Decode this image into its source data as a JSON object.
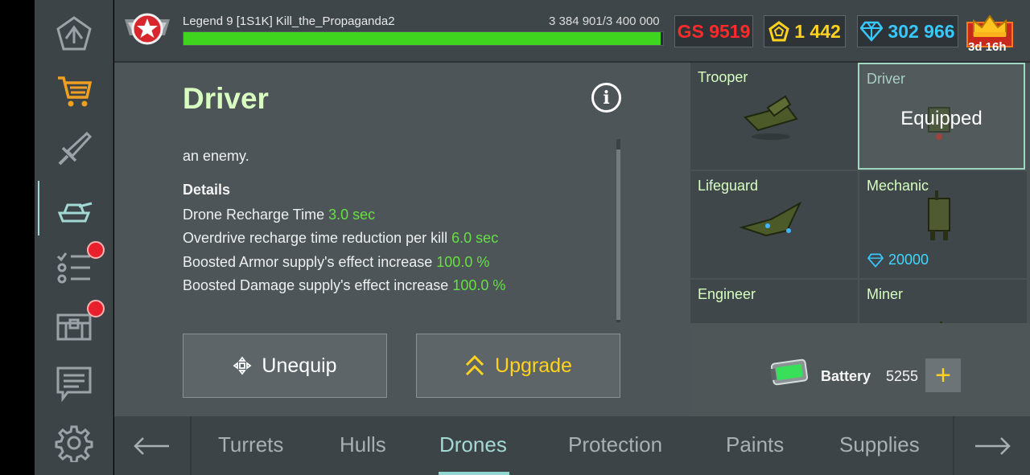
{
  "sidebar": {
    "items": [
      {
        "name": "home"
      },
      {
        "name": "shop"
      },
      {
        "name": "garage-weapons"
      },
      {
        "name": "garage-tanks",
        "active": true
      },
      {
        "name": "missions",
        "badge": true
      },
      {
        "name": "containers",
        "badge": true
      },
      {
        "name": "news"
      },
      {
        "name": "settings"
      }
    ]
  },
  "topbar": {
    "player": "Legend 9  [1S1K] Kill_the_Propaganda2",
    "xp": "3 384 901/3 400 000",
    "xp_progress": 0.9955,
    "gear_score": "GS 9519",
    "crystals": "1 442",
    "rubies": "302 966",
    "premium_time": "3d 16h"
  },
  "detail": {
    "title": "Driver",
    "description_tail": "an enemy.",
    "details_heading": "Details",
    "stats": [
      {
        "label": "Drone Recharge Time",
        "value": "3.0 sec"
      },
      {
        "label": "Overdrive recharge time reduction per kill",
        "value": "6.0 sec"
      },
      {
        "label": "Boosted Armor supply's effect increase",
        "value": "100.0 %"
      },
      {
        "label": "Boosted Damage supply's effect increase",
        "value": "100.0 %"
      }
    ],
    "unequip_label": "Unequip",
    "upgrade_label": "Upgrade"
  },
  "drones": [
    {
      "name": "Trooper"
    },
    {
      "name": "Driver",
      "status": "Equipped"
    },
    {
      "name": "Lifeguard"
    },
    {
      "name": "Mechanic",
      "price": "20000"
    },
    {
      "name": "Engineer"
    },
    {
      "name": "Miner"
    }
  ],
  "battery": {
    "label": "Battery",
    "count": "5255",
    "add": "+"
  },
  "tabs": [
    "Turrets",
    "Hulls",
    "Drones",
    "Protection",
    "Paints",
    "Supplies"
  ],
  "active_tab": "Drones",
  "colors": {
    "accent_green": "#66e043",
    "gold": "#ffd21f",
    "cyan": "#37c8ff",
    "gs_red": "#ff2a2a"
  }
}
